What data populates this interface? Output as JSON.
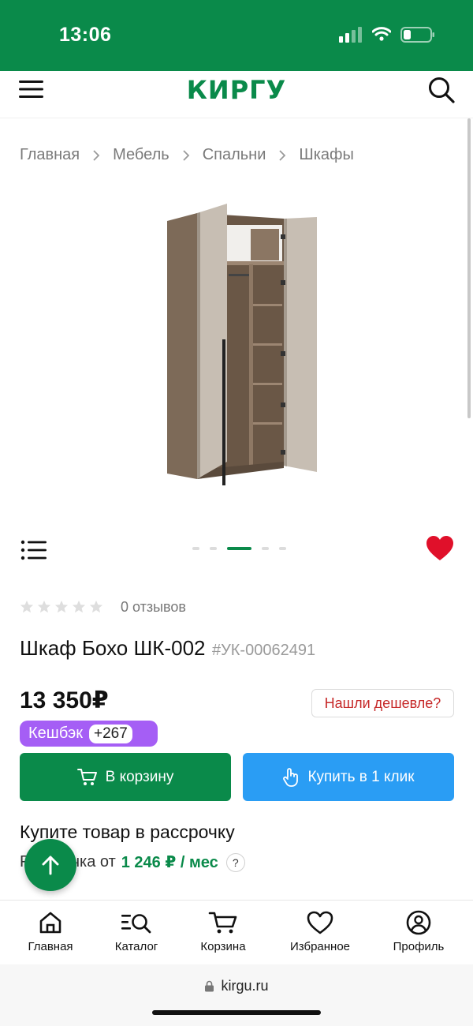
{
  "status_bar": {
    "time": "13:06"
  },
  "header": {
    "logo": "КИРГУ"
  },
  "breadcrumb": {
    "items": [
      "Главная",
      "Мебель",
      "Спальни",
      "Шкафы"
    ]
  },
  "gallery": {
    "total_slides": 5,
    "active_slide": 3
  },
  "product": {
    "rating": 0,
    "rating_max": 5,
    "reviews": "0 отзывов",
    "title": "Шкаф Бохо ШК-002",
    "sku": "#УК-00062491",
    "price": "13 350₽",
    "cheaper_label": "Нашли дешевле?",
    "cashback_label": "Кешбэк",
    "cashback_value": "+267",
    "add_to_cart": "В корзину",
    "buy_one_click": "Купить в 1 клик"
  },
  "installment": {
    "heading": "Купите товар в рассрочку",
    "prefix": "Рассрочка от",
    "amount": "1 246 ₽ / мес",
    "help": "?"
  },
  "nav": {
    "home": "Главная",
    "catalog": "Каталог",
    "cart": "Корзина",
    "favorites": "Избранное",
    "profile": "Профиль"
  },
  "browser": {
    "url": "kirgu.ru"
  },
  "colors": {
    "brand": "#0a8a4a",
    "oneclick": "#2a9df4",
    "cashback": "#a55ef5",
    "favorite": "#e0102a",
    "cheaper_text": "#c62828"
  },
  "icons": {
    "status": [
      "signal-icon",
      "wifi-icon",
      "battery-icon"
    ],
    "header": [
      "menu-icon",
      "search-icon"
    ],
    "gallery": [
      "list-icon",
      "heart-icon"
    ],
    "nav": [
      "home-icon",
      "catalog-icon",
      "cart-icon",
      "heart-icon",
      "profile-icon"
    ]
  }
}
